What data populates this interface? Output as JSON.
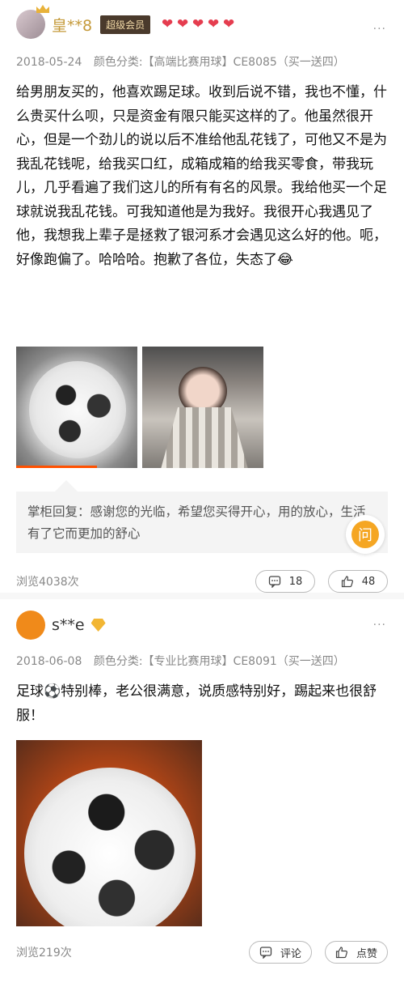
{
  "review1": {
    "username": "皇**8",
    "vip_label": "超级会员",
    "hearts": [
      "❤",
      "❤",
      "❤",
      "❤",
      "❤"
    ],
    "more": "···",
    "date": "2018-05-24",
    "sku": "颜色分类:【高端比赛用球】CE8085（买一送四）",
    "text": "给男朋友买的，他喜欢踢足球。收到后说不错，我也不懂，什么贵买什么呗，只是资金有限只能买这样的了。他虽然很开心，但是一个劲儿的说以后不准给他乱花钱了，可他又不是为我乱花钱呢，给我买口红，成箱成箱的给我买零食，带我玩儿，几乎看遍了我们这儿的所有有名的风景。我给他买一个足球就说我乱花钱。可我知道他是为我好。我很开心我遇见了他，我想我上辈子是拯救了银河系才会遇见这么好的他。呃，好像跑偏了。哈哈哈。抱歉了各位，失态了😂",
    "reply": "掌柜回复：感谢您的光临，希望您买得开心，用的放心，生活有了它而更加的舒心",
    "ask_label": "问",
    "views": "浏览4038次",
    "comment_count": "18",
    "like_count": "48"
  },
  "review2": {
    "username": "s**e",
    "more": "···",
    "date": "2018-06-08",
    "sku": "颜色分类:【专业比赛用球】CE8091（买一送四）",
    "text": "足球⚽特别棒，老公很满意，说质感特别好，踢起来也很舒服！",
    "views": "浏览219次",
    "comment_label": "评论",
    "like_label": "点赞"
  },
  "colors": {
    "accent": "#ff5000",
    "vip_badge": "#4a3a2c",
    "username_gold": "#c59a3a",
    "heart": "#e53d4f",
    "ask": "#f5a623"
  }
}
